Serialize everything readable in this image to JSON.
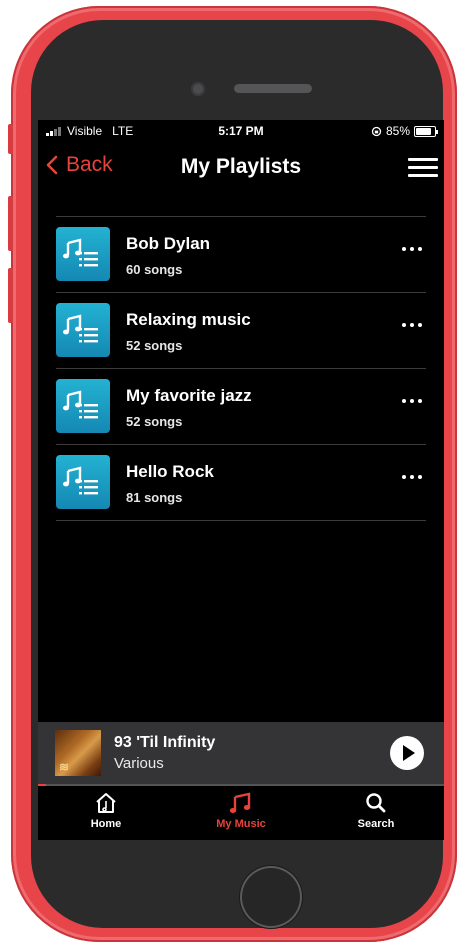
{
  "status_bar": {
    "carrier": "Visible",
    "network": "LTE",
    "time": "5:17 PM",
    "battery": "85%"
  },
  "nav": {
    "back_label": "Back",
    "title": "My Playlists"
  },
  "playlists": [
    {
      "name": "Bob Dylan",
      "count": "60 songs"
    },
    {
      "name": "Relaxing music",
      "count": "52 songs"
    },
    {
      "name": "My favorite jazz",
      "count": "52 songs"
    },
    {
      "name": "Hello Rock",
      "count": "81 songs"
    }
  ],
  "now_playing": {
    "title": "93 'Til Infinity",
    "artist": "Various"
  },
  "tabs": {
    "home": "Home",
    "my_music": "My Music",
    "search": "Search"
  },
  "colors": {
    "accent": "#e8433a",
    "phone_body": "#e8454a",
    "playlist_tile": "#1a9cc4"
  },
  "icons": {
    "back": "chevron-left-icon",
    "menu": "hamburger-menu-icon",
    "playlist": "music-list-icon",
    "more": "ellipsis-icon",
    "play": "play-icon",
    "home": "home-icon",
    "my_music": "music-notes-icon",
    "search": "search-icon"
  }
}
